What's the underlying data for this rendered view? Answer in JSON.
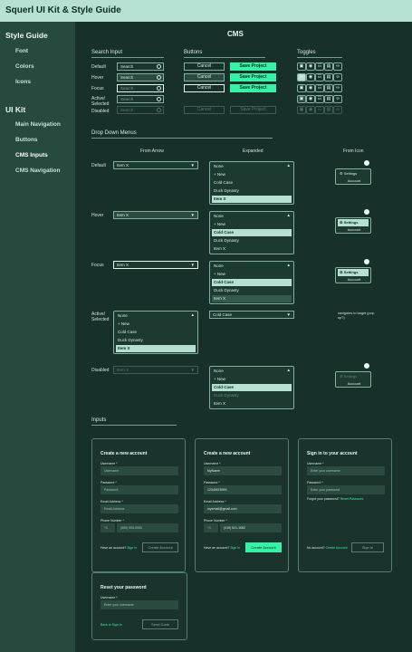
{
  "app_title": "Squerl UI Kit & Style Guide",
  "sidebar": {
    "style_guide": "Style Guide",
    "font": "Font",
    "colors": "Colors",
    "icons": "Icons",
    "ui_kit": "UI Kit",
    "main_navigation": "Main Navigation",
    "buttons": "Buttons",
    "cms_inputs": "CMS Inputs",
    "cms_navigation": "CMS Navigation"
  },
  "page_title": "CMS",
  "sections": {
    "search_input": "Search Input",
    "buttons": "Buttons",
    "toggles": "Toggles",
    "dropdown_menus": "Drop Down Menus",
    "inputs": "Inputs"
  },
  "states": {
    "default": "Default",
    "hover": "Hover",
    "focus": "Focus",
    "active": "Active/ Selected",
    "disabled": "Disabled"
  },
  "search": {
    "value": "Search"
  },
  "buttons": {
    "cancel": "Cancel",
    "save": "Save Project"
  },
  "dropdown_cols": {
    "from_arrow": "From Arrow",
    "expanded": "Expanded",
    "from_icon": "From Icon"
  },
  "dropdown": {
    "selected": "Item X",
    "none": "None",
    "cold_case": "Cold Case",
    "options": [
      "None",
      "+ New",
      "Cold Case",
      "Duck Dynasty",
      "Item X"
    ],
    "settings": "Settings",
    "account": "Account",
    "nav_note": "navigates to target (pop-up?)"
  },
  "forms": {
    "create_title": "Create a new account",
    "signin_title": "Sign in to your account",
    "reset_title": "Reset your password",
    "username_label": "Username *",
    "password_label": "Password *",
    "email_label": "Email Address *",
    "phone_label": "Phone Number *",
    "username_ph": "Username",
    "password_ph": "Password",
    "email_ph": "Email Address",
    "phone_code": "+1",
    "phone_ph": "(555) 555-5555",
    "filled_username": "MyName",
    "filled_password": "12345678999",
    "filled_email": "myemail@gmail.com",
    "filled_phone": "(415) 521-1682",
    "enter_username": "Enter your username",
    "enter_password": "Enter your password",
    "forgot_text": "Forgot your password?",
    "reset_link": "Reset Password",
    "have_account": "Have an account?",
    "sign_in_link": "Sign in",
    "no_account": "No account?",
    "create_link": "Create Account",
    "create_btn": "Create Account",
    "sign_in_btn": "Sign In",
    "back_link": "Back to Sign In",
    "send_code_btn": "Send Code"
  },
  "colors": {
    "accent": "#36f2a6",
    "topbar": "#b6e0d1",
    "sidebar": "#264a3e",
    "bg": "#17302a"
  }
}
